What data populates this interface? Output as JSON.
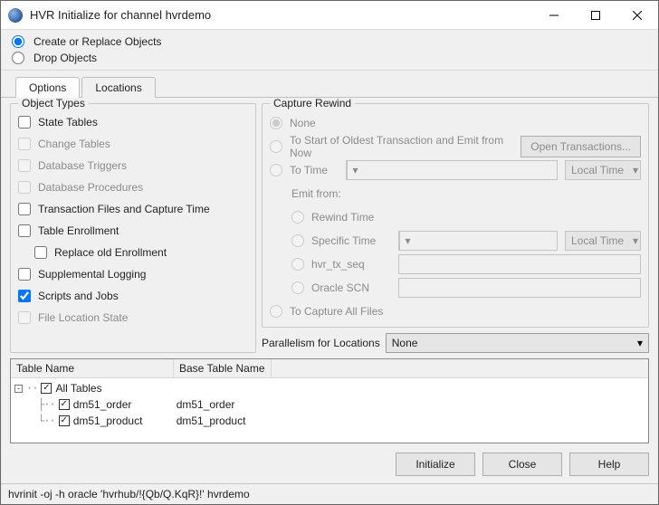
{
  "window": {
    "title": "HVR Initialize for channel hvrdemo"
  },
  "modeRadios": {
    "createReplace": "Create or Replace Objects",
    "drop": "Drop Objects"
  },
  "tabs": {
    "options": "Options",
    "locations": "Locations"
  },
  "objectTypes": {
    "legend": "Object Types",
    "stateTables": "State Tables",
    "changeTables": "Change Tables",
    "dbTriggers": "Database Triggers",
    "dbProcedures": "Database Procedures",
    "txFiles": "Transaction Files and Capture Time",
    "tableEnroll": "Table Enrollment",
    "replaceOld": "Replace old Enrollment",
    "suppLogging": "Supplemental Logging",
    "scriptsJobs": "Scripts and Jobs",
    "fileLocState": "File Location State"
  },
  "captureRewind": {
    "legend": "Capture Rewind",
    "none": "None",
    "toStart": "To Start of Oldest Transaction and Emit from Now",
    "openTx": "Open Transactions...",
    "toTime": "To Time",
    "localTime": "Local Time",
    "emitFrom": "Emit from:",
    "rewindTime": "Rewind Time",
    "specificTime": "Specific Time",
    "hvrTxSeq": "hvr_tx_seq",
    "oracleSCN": "Oracle SCN",
    "captureAll": "To Capture All Files"
  },
  "parallelism": {
    "label": "Parallelism for Locations",
    "value": "None"
  },
  "table": {
    "headers": {
      "c1": "Table Name",
      "c2": "Base Table Name"
    },
    "root": "All Tables",
    "rows": [
      {
        "name": "dm51_order",
        "base": "dm51_order"
      },
      {
        "name": "dm51_product",
        "base": "dm51_product"
      }
    ]
  },
  "buttons": {
    "initialize": "Initialize",
    "close": "Close",
    "help": "Help"
  },
  "cmdline": "hvrinit -oj -h oracle 'hvrhub/!{Qb/Q.KqR}!' hvrdemo"
}
